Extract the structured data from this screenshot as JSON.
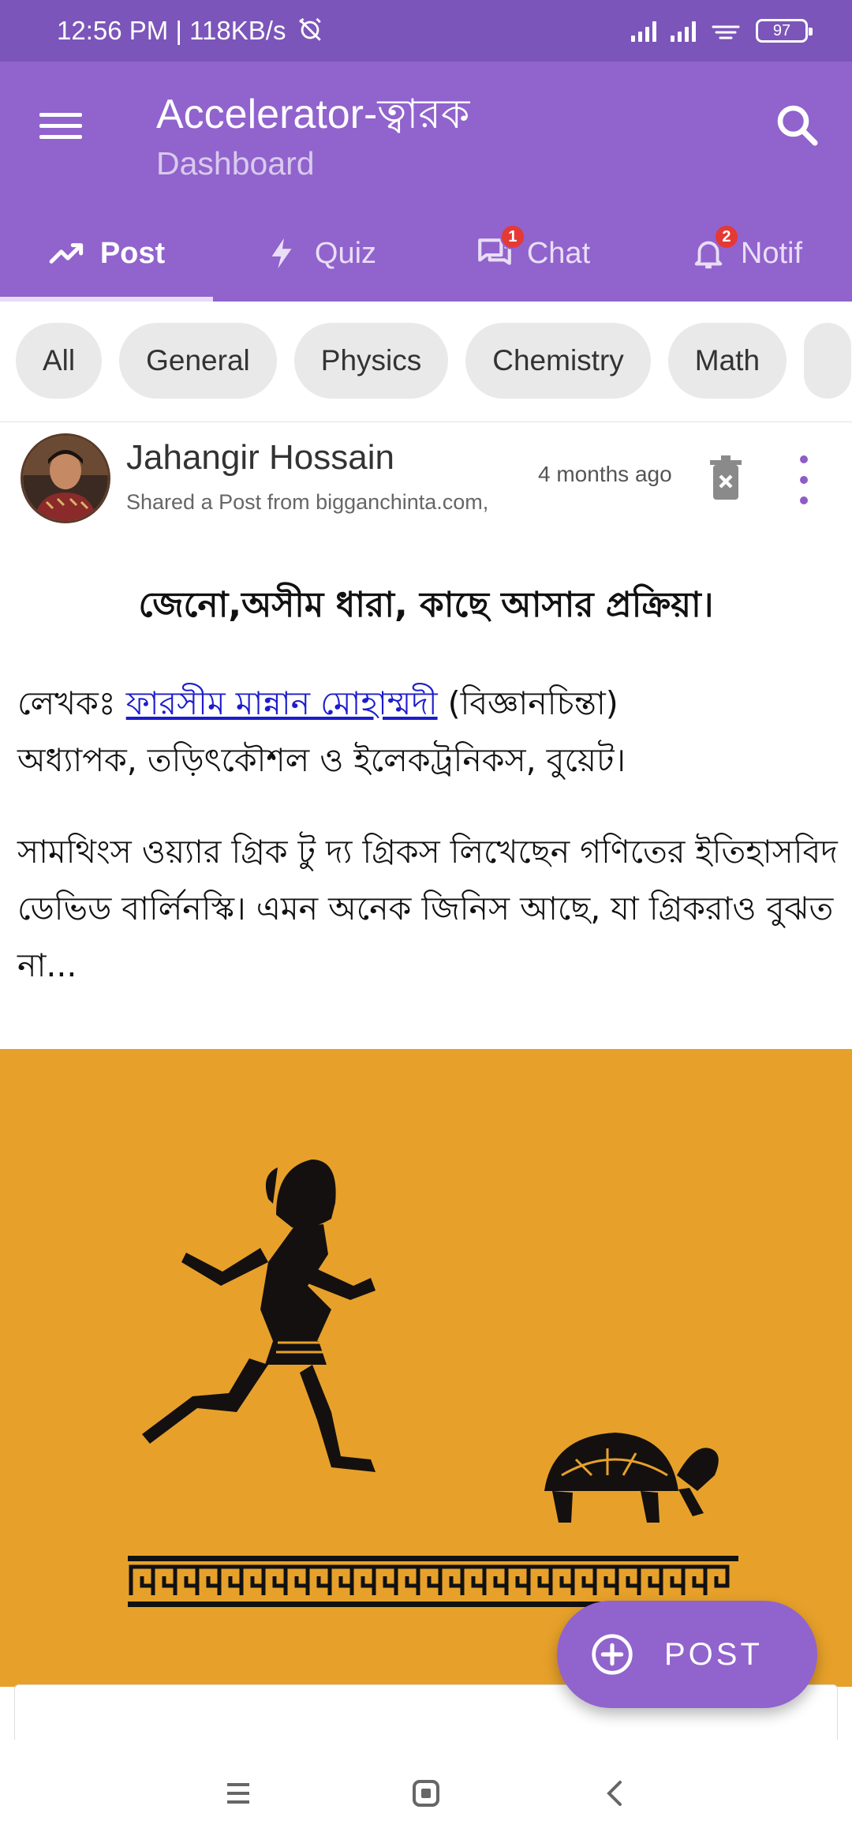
{
  "status_bar": {
    "time_speed": "12:56 PM | 118KB/s",
    "battery": "97"
  },
  "app_bar": {
    "title": "Accelerator-ত্বারক",
    "subtitle": "Dashboard",
    "icons": [
      "menu-icon",
      "search-icon"
    ]
  },
  "tabs": [
    {
      "label": "Post",
      "icon": "trending-icon",
      "active": true
    },
    {
      "label": "Quiz",
      "icon": "bolt-icon"
    },
    {
      "label": "Chat",
      "icon": "chat-icon",
      "badge": "1"
    },
    {
      "label": "Notif",
      "icon": "bell-icon",
      "badge": "2"
    }
  ],
  "chips": [
    "All",
    "General",
    "Physics",
    "Chemistry",
    "Math"
  ],
  "post": {
    "author": "Jahangir Hossain",
    "shared": "Shared a Post from bigganchinta.com,",
    "time": "4 months ago",
    "title": "জেনো,অসীম ধারা, কাছে আসার প্রক্রিয়া।",
    "byline_prefix": "লেখকঃ ",
    "byline_author": "ফারসীম মান্নান মোহাম্মদী",
    "byline_suffix": " (বিজ্ঞানচিন্তা)",
    "byline_role": "অধ্যাপক, তড়িৎকৌশল ও ইলেকট্রনিকস, বুয়েট।",
    "excerpt": "সামথিংস ওয়্যার গ্রিক টু দ্য গ্রিকস লিখেছেন গণিতের ইতিহাসবিদ ডেভিড বার্লিনস্কি। এমন অনেক জিনিস আছে, যা গ্রিকরাও বুঝত না...",
    "image_bg": "#e7a12a"
  },
  "fab": {
    "label": "POST",
    "icon": "add-circle-icon"
  },
  "nav": [
    "recents-icon",
    "home-icon",
    "back-icon"
  ],
  "colors": {
    "status_bar": "#7b55b9",
    "primary": "#9163cd",
    "badge": "#e53935",
    "link": "#1c1ccc"
  }
}
